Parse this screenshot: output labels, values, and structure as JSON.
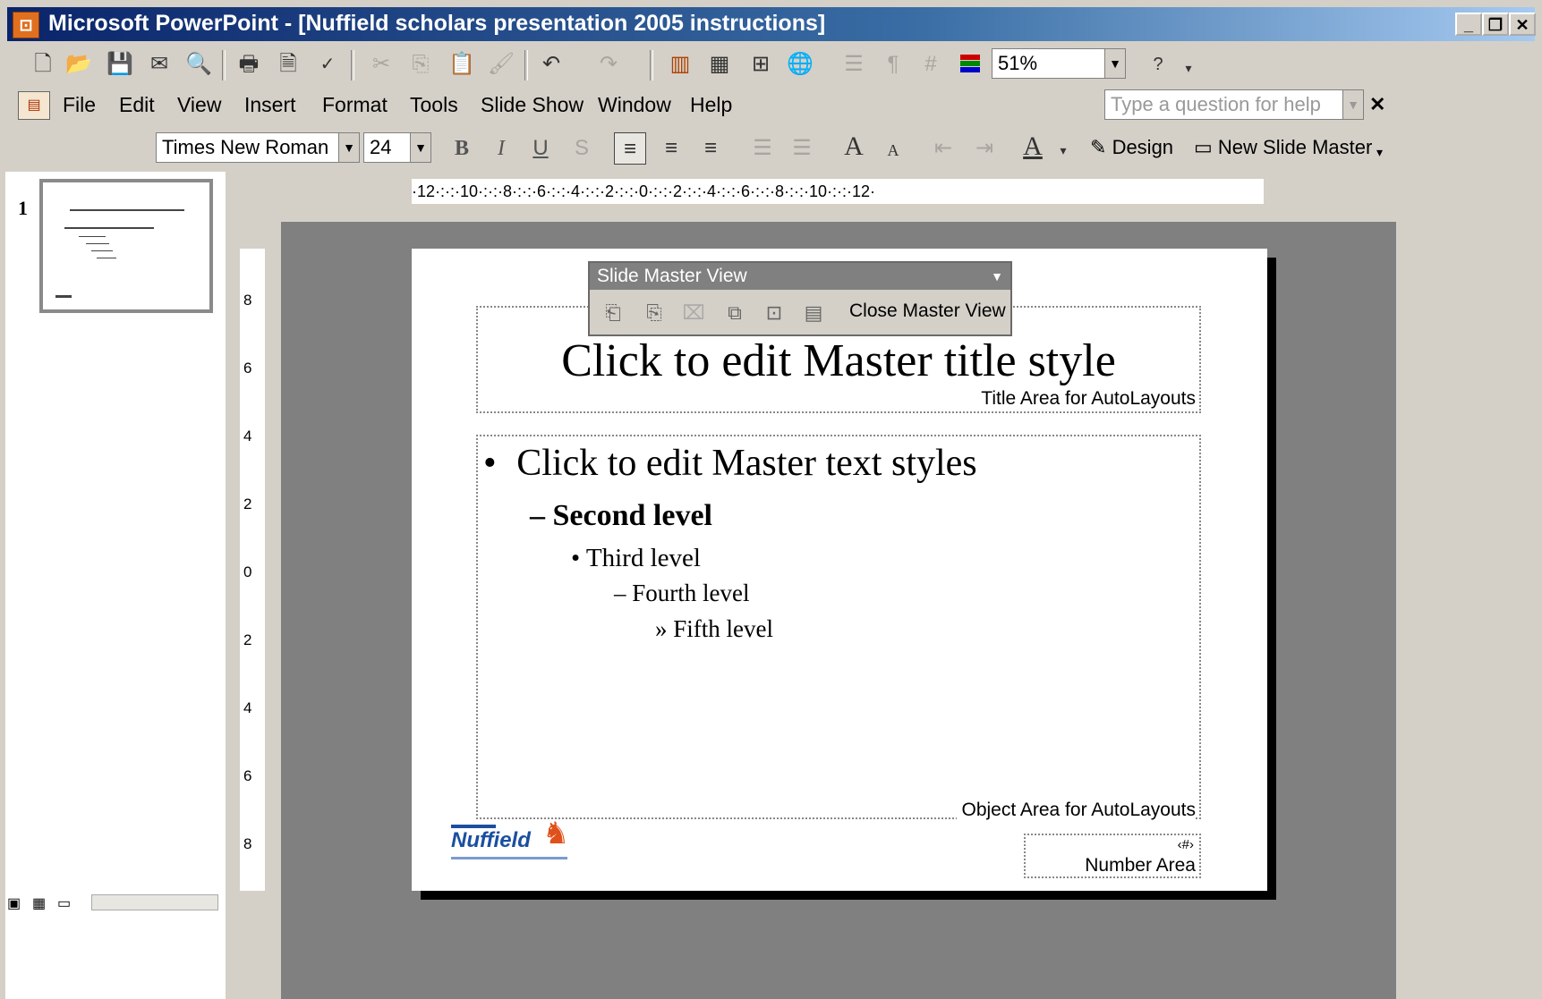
{
  "window": {
    "title": "Microsoft PowerPoint - [Nuffield scholars presentation 2005 instructions]",
    "app_icon": "powerpoint-icon",
    "controls": [
      "minimize-icon",
      "restore-icon",
      "close-icon"
    ]
  },
  "standard_toolbar": {
    "zoom": "51%",
    "buttons": [
      "new-icon",
      "open-icon",
      "save-icon",
      "permission-icon",
      "search-icon",
      "print-icon",
      "print-preview-icon",
      "spelling-icon",
      "cut-icon",
      "copy-icon",
      "paste-icon",
      "format-painter-icon",
      "undo-icon",
      "redo-icon",
      "insert-chart-icon",
      "insert-table-icon",
      "tables-borders-icon",
      "insert-hyperlink-icon",
      "expand-all-icon",
      "show-formatting-icon",
      "show-grid-icon",
      "color-grayscale-icon",
      "help-icon"
    ]
  },
  "menu": {
    "items": [
      "File",
      "Edit",
      "View",
      "Insert",
      "Format",
      "Tools",
      "Slide Show",
      "Window",
      "Help"
    ],
    "help_placeholder": "Type a question for help"
  },
  "format_toolbar": {
    "font": "Times New Roman",
    "size": "24",
    "bold": "B",
    "italic": "I",
    "underline": "U",
    "design": "Design",
    "new_slide_master": "New Slide Master"
  },
  "ruler": {
    "horizontal": "·12·:·:·10·:·:·8·:·:·6·:·:·4·:·:·2·:·:·0·:·:·2·:·:·4·:·:·6·:·:·8·:·:·10·:·:·12·",
    "vertical": [
      "8",
      "6",
      "4",
      "2",
      "0",
      "2",
      "4",
      "6",
      "8"
    ]
  },
  "thumbnails": [
    {
      "number": "1"
    }
  ],
  "slide_master_view": {
    "title": "Slide Master View",
    "close_label": "Close Master View",
    "buttons": [
      "insert-new-slide-master-icon",
      "insert-new-title-master-icon",
      "delete-master-icon",
      "preserve-master-icon",
      "rename-master-icon",
      "master-layout-icon"
    ]
  },
  "slide": {
    "title": "Click to edit Master title style",
    "title_area_label": "Title Area for AutoLayouts",
    "levels": {
      "first": "Click to edit Master text styles",
      "second": "Second level",
      "third": "Third level",
      "fourth": "Fourth level",
      "fifth": "Fifth level"
    },
    "bullets": {
      "first": "•",
      "second": "–",
      "third": "•",
      "fourth": "–",
      "fifth": "»"
    },
    "object_area_label": "Object Area for AutoLayouts",
    "number_symbol": "‹#›",
    "number_area_label": "Number Area",
    "logo_text": "Nuffield"
  },
  "colors": {
    "titlebar_start": "#0a246a",
    "titlebar_end": "#a6caf0",
    "chrome": "#d4d0c8",
    "workspace": "#808080",
    "logo_blue": "#1a4fa0",
    "logo_orange": "#e0501a"
  }
}
